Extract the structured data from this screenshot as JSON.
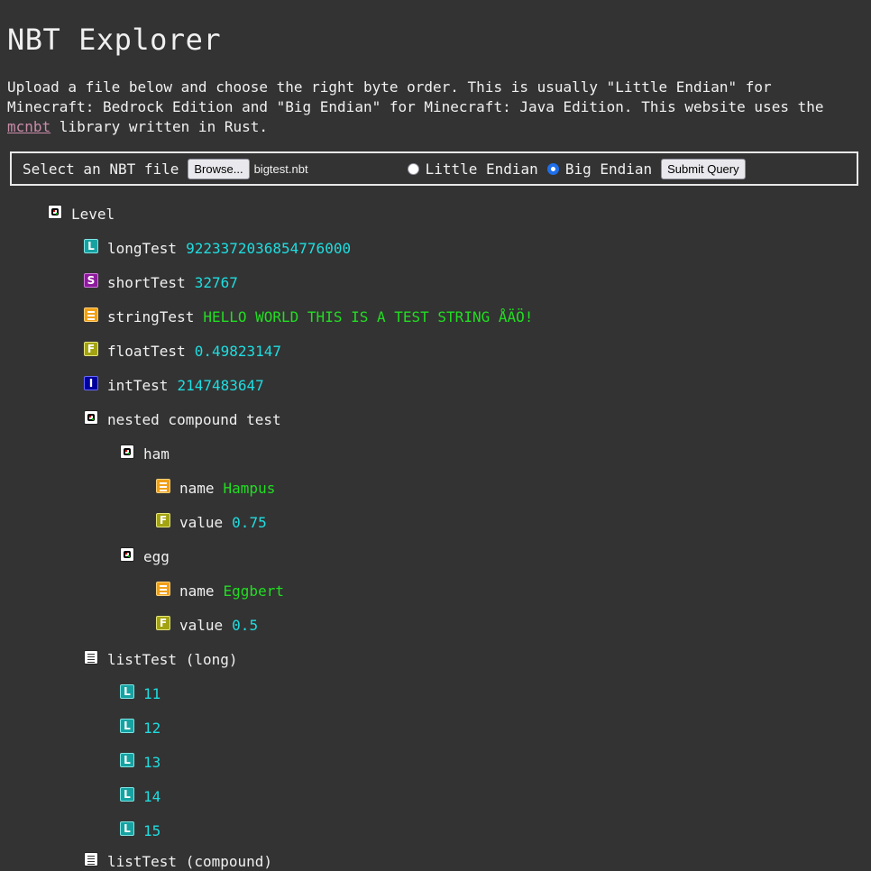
{
  "page": {
    "title": "NBT Explorer",
    "intro_text": "Upload a file below and choose the right byte order. This is usually \"Little Endian\" for\nMinecraft: Bedrock Edition and \"Big Endian\" for Minecraft: Java Edition. This website uses the\n",
    "intro_link": "mcnbt",
    "intro_suffix": " library written in Rust."
  },
  "form": {
    "select_label": "Select an NBT file",
    "browse_label": "Browse...",
    "file_name": "bigtest.nbt",
    "option_little": "Little Endian",
    "option_big": "Big Endian",
    "selected_order": "Big Endian",
    "submit_label": "Submit Query"
  },
  "tree": {
    "level": {
      "key": "Level",
      "type": "compound"
    },
    "longTest": {
      "key": "longTest",
      "value": "9223372036854776000",
      "type": "long"
    },
    "shortTest": {
      "key": "shortTest",
      "value": "32767",
      "type": "short"
    },
    "stringTest": {
      "key": "stringTest",
      "value": "HELLO WORLD THIS IS A TEST STRING ÅÄÖ!",
      "type": "string"
    },
    "floatTest": {
      "key": "floatTest",
      "value": "0.49823147",
      "type": "float"
    },
    "intTest": {
      "key": "intTest",
      "value": "2147483647",
      "type": "int"
    },
    "nested": {
      "key": "nested compound test",
      "type": "compound"
    },
    "ham": {
      "key": "ham",
      "type": "compound"
    },
    "ham_name": {
      "key": "name",
      "value": "Hampus",
      "type": "string"
    },
    "ham_value": {
      "key": "value",
      "value": "0.75",
      "type": "float"
    },
    "egg": {
      "key": "egg",
      "type": "compound"
    },
    "egg_name": {
      "key": "name",
      "value": "Eggbert",
      "type": "string"
    },
    "egg_value": {
      "key": "value",
      "value": "0.5",
      "type": "float"
    },
    "listLong": {
      "key": "listTest (long)",
      "type": "list"
    },
    "list_items": [
      "11",
      "12",
      "13",
      "14",
      "15"
    ],
    "listCompound": {
      "key": "listTest (compound)",
      "type": "list"
    }
  },
  "icons": {
    "long": "long-tag-icon",
    "short": "short-tag-icon",
    "string": "string-tag-icon",
    "float": "float-tag-icon",
    "int": "int-tag-icon",
    "compound": "compound-tag-icon",
    "list": "list-tag-icon"
  },
  "colors": {
    "background": "#333333",
    "number_value": "#1fdde0",
    "string_value": "#22dd22",
    "link": "#c98ba9"
  }
}
